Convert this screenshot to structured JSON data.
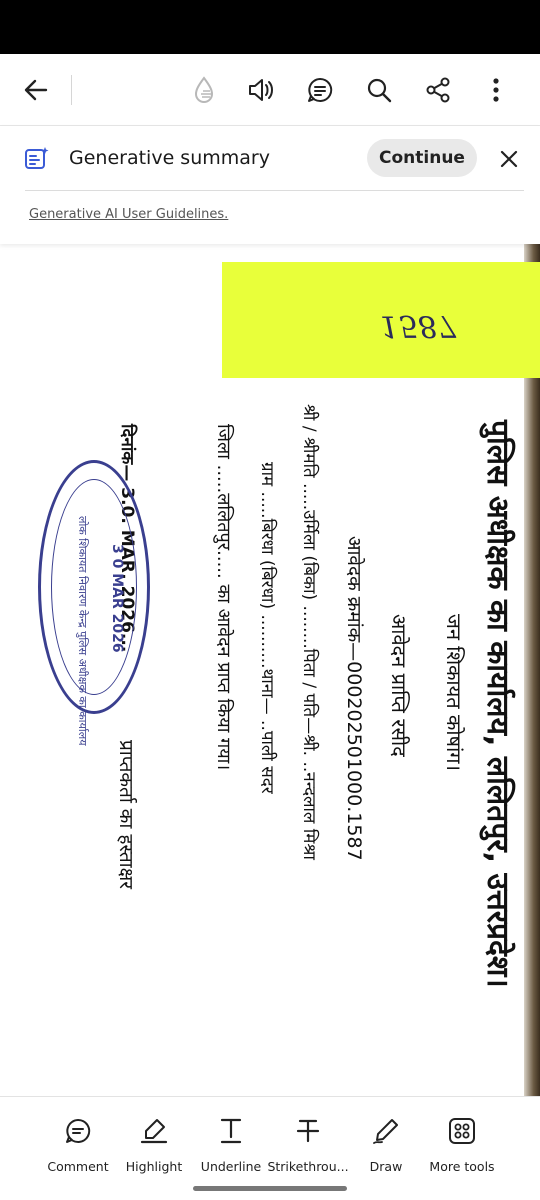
{
  "toolbar": {
    "back_icon": "arrow-left-icon",
    "icons": [
      "liquid-mode-icon",
      "read-aloud-icon",
      "comments-icon",
      "search-icon",
      "share-icon",
      "more-vertical-icon"
    ]
  },
  "summary": {
    "title": "Generative summary",
    "continue_label": "Continue",
    "guidelines_link": "Generative AI User Guidelines."
  },
  "document": {
    "sticky_note": "1587",
    "header_line": "पुलिस अधीक्षक का कार्यालय, ललितपुर, उत्तरप्रदेश।",
    "subhead_1": "जन शिकायत कोषांग।",
    "subhead_2": "आवेदन प्राप्ति रसीद",
    "line_1": "आवेदक क्रमांक—000202501000.1587",
    "line_2": "श्री / श्रीमति .....उर्मिला (बिका) ........पिता / पति—श्री. ..नन्दलाल मिश्रा",
    "line_3": "ग्राम .....बिरधा (बिरधा) ..........थाना— ..पाली सदर",
    "line_4": "जिला .....ललितपुर..... का आवेदन प्राप्त किया गया।",
    "date_line": "दिनांक— 3.0. MAR. 2026...",
    "signature_line": "प्राप्तकर्ता का हस्ताक्षर",
    "stamp_outer": "लोक शिकायत निवारण केन्द्र पुलिस अधीक्षक का कार्यालय",
    "stamp_date": "3 0 MAR 2026",
    "stamp_color": "#3a3f8f"
  },
  "bottom_tools": [
    {
      "label": "Comment",
      "icon": "comment-icon"
    },
    {
      "label": "Highlight",
      "icon": "highlight-icon"
    },
    {
      "label": "Underline",
      "icon": "underline-icon"
    },
    {
      "label": "Strikethrou...",
      "icon": "strikethrough-icon"
    },
    {
      "label": "Draw",
      "icon": "draw-icon"
    },
    {
      "label": "More tools",
      "icon": "more-tools-icon"
    }
  ]
}
